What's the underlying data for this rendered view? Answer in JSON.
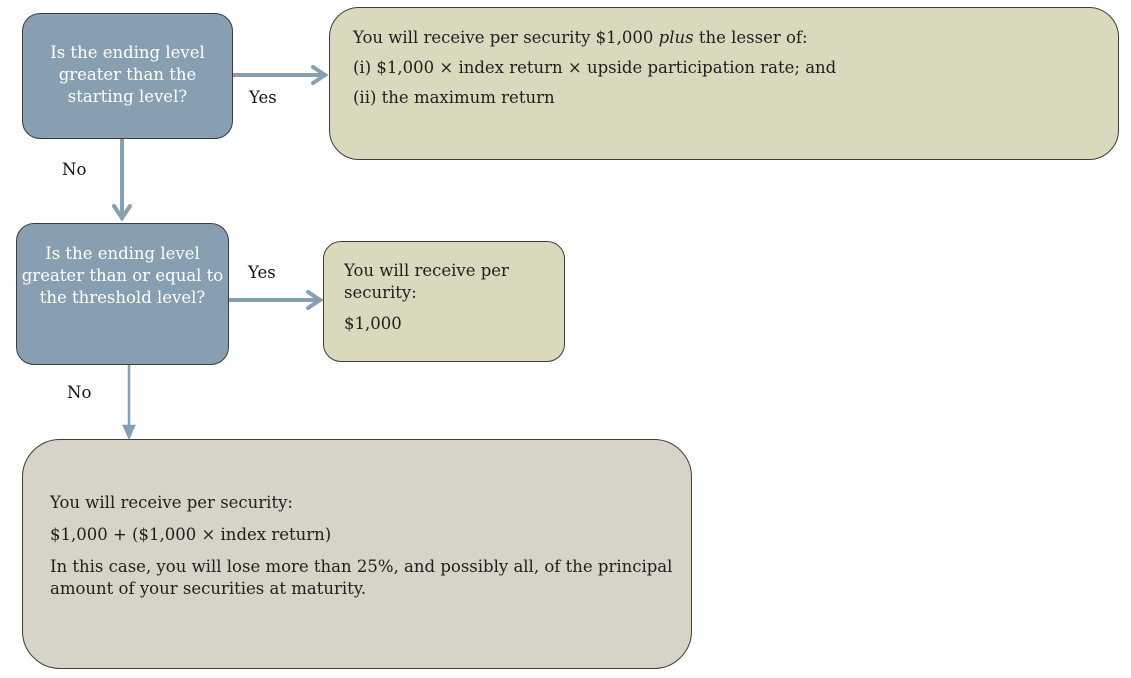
{
  "colors": {
    "question_fill": "#879fb0",
    "answer_fill": "#dad9bd",
    "loss_fill": "#d7d3c6",
    "arrow": "#879fb0"
  },
  "question1": {
    "text": "Is the ending level greater than the starting level?"
  },
  "question2": {
    "text": "Is the ending level greater than or equal to the threshold level?"
  },
  "labels": {
    "yes1": "Yes",
    "no1": "No",
    "yes2": "Yes",
    "no2": "No"
  },
  "outcome1": {
    "line1_pre": "You will receive per security $1,000 ",
    "line1_em": "plus",
    "line1_post": " the lesser of:",
    "line2": "(i) $1,000 × index return × upside participation rate; and",
    "line3": "(ii) the maximum return"
  },
  "outcome2": {
    "line1": "You will receive per security:",
    "line2": "$1,000"
  },
  "outcome3": {
    "line1": "You will receive per security:",
    "line2": "$1,000 + ($1,000 × index return)",
    "line3": "In this case, you will lose more than 25%, and possibly all, of the principal amount of your securities at maturity."
  }
}
